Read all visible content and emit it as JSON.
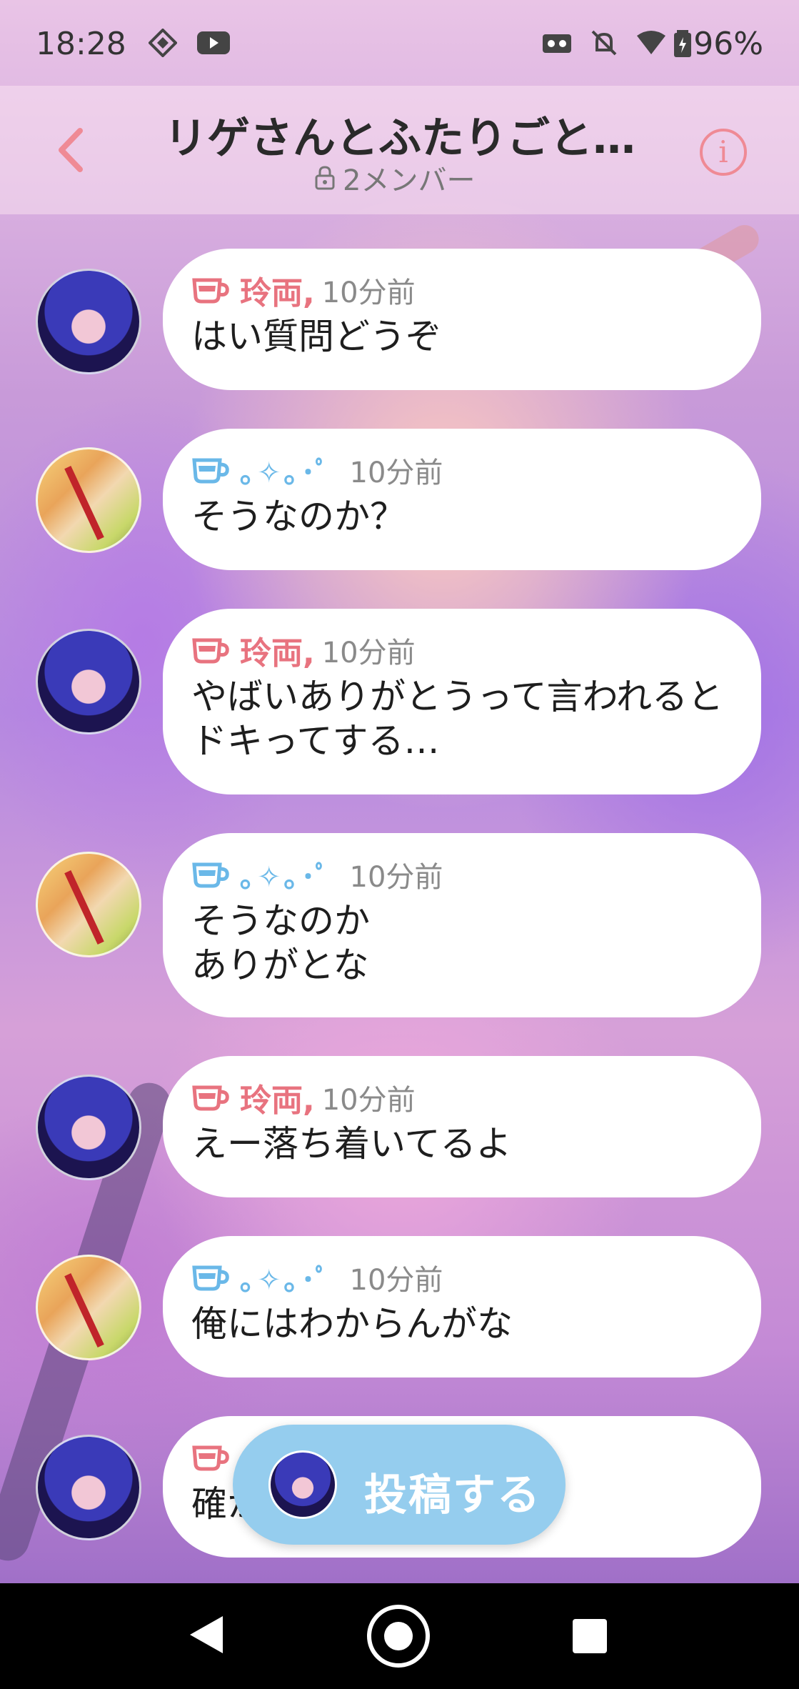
{
  "status_bar": {
    "time": "18:28",
    "battery": "96%"
  },
  "header": {
    "title": "リゲさんとふたりごと…",
    "members": "2メンバー"
  },
  "messages": [
    {
      "author": "rei",
      "name": "玲両,",
      "time": "10分前",
      "text": "はい質問どうぞ"
    },
    {
      "author": "sp",
      "name": "｡✧｡･ﾟ",
      "time": "10分前",
      "text": "そうなのか？"
    },
    {
      "author": "rei",
      "name": "玲両,",
      "time": "10分前",
      "text": "やばいありがとうって言われると\nドキってする…"
    },
    {
      "author": "sp",
      "name": "｡✧｡･ﾟ",
      "time": "10分前",
      "text": "そうなのか\nありがとな"
    },
    {
      "author": "rei",
      "name": "玲両,",
      "time": "10分前",
      "text": "えー落ち着いてるよ"
    },
    {
      "author": "sp",
      "name": "｡✧｡･ﾟ",
      "time": "10分前",
      "text": "俺にはわからんがな"
    },
    {
      "author": "rei",
      "name": "",
      "time": "",
      "text": "確か"
    }
  ],
  "post_button": {
    "label": "投稿する"
  },
  "colors": {
    "accent_pink": "#e8737f",
    "accent_blue": "#6ab8e8",
    "post_button": "#95cdee"
  },
  "icons": [
    "signal-icon",
    "youtube-icon",
    "vpn-icon",
    "mute-bell-icon",
    "wifi-icon",
    "battery-icon",
    "back-arrow-icon",
    "info-icon",
    "lock-icon",
    "cup-icon"
  ]
}
